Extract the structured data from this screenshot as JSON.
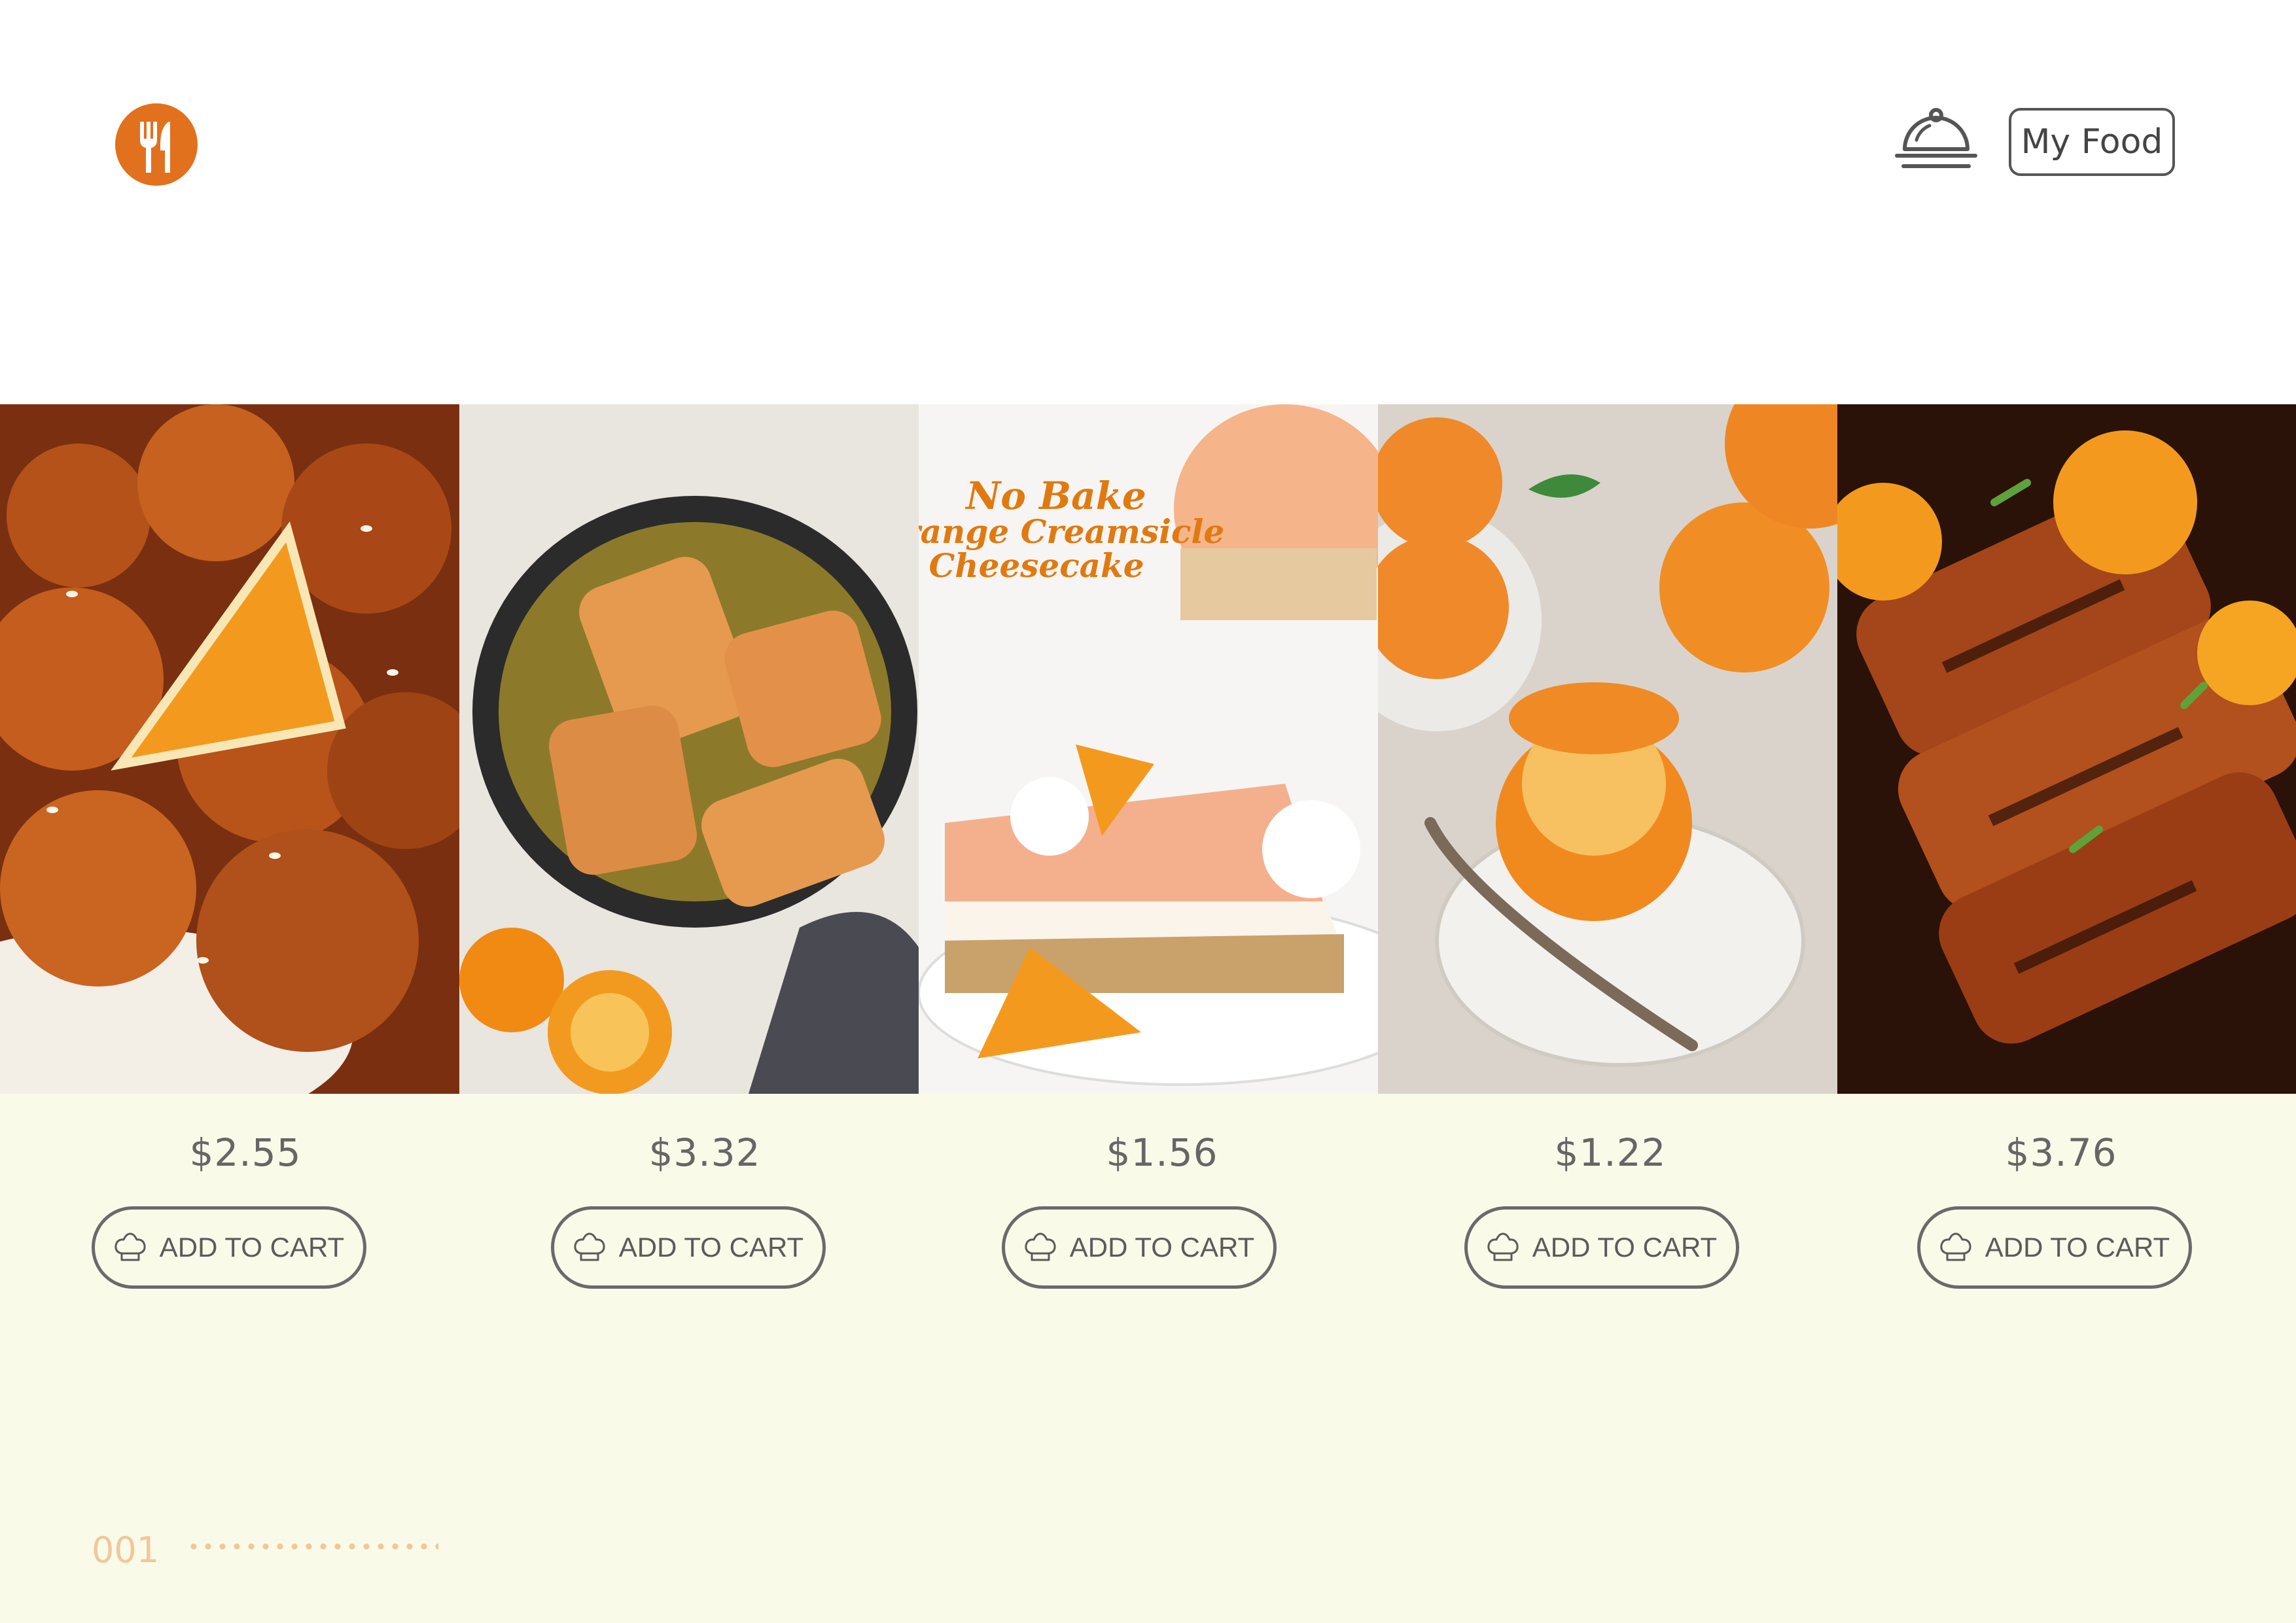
{
  "header": {
    "logo_icon": "fork-knife-icon",
    "cloche_icon": "food-cloche-icon",
    "my_food_label": "My Food",
    "accent_color": "#e2711d"
  },
  "photo_overlay": {
    "line1": "No Bake",
    "line2": "Orange Creamsicle",
    "line3": "Cheesecake"
  },
  "products": [
    {
      "price": "$2.55",
      "button_label": "ADD TO CART",
      "button_icon": "chef-hat-icon"
    },
    {
      "price": "$3.32",
      "button_label": "ADD TO CART",
      "button_icon": "chef-hat-icon"
    },
    {
      "price": "$1.56",
      "button_label": "ADD TO CART",
      "button_icon": "chef-hat-icon"
    },
    {
      "price": "$1.22",
      "button_label": "ADD TO CART",
      "button_icon": "chef-hat-icon"
    },
    {
      "price": "$3.76",
      "button_label": "ADD TO CART",
      "button_icon": "chef-hat-icon"
    }
  ],
  "footer": {
    "page_number": "001"
  },
  "colors": {
    "panel_background": "#fafae9",
    "page_number": "#f1c79a",
    "button_border": "#6a6a6a"
  }
}
